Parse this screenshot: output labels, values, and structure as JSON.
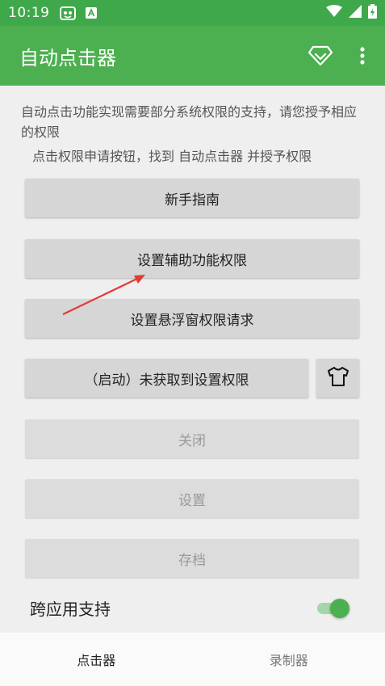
{
  "status": {
    "time": "10:19",
    "icons": [
      "tomcat-app-icon",
      "text-a-icon",
      "wifi-icon",
      "signal-icon",
      "battery-icon"
    ]
  },
  "app_bar": {
    "title": "自动点击器",
    "actions": [
      "diamond-icon",
      "more-vert-icon"
    ]
  },
  "colors": {
    "status_bar": "#3fa84a",
    "app_bar": "#4caf50",
    "switch_thumb": "#4caf50",
    "switch_track": "#a5d6a7",
    "arrow": "#e53935"
  },
  "content": {
    "description": "自动点击功能实现需要部分系统权限的支持，请您授予相应的权限",
    "hint": "点击权限申请按钮，找到 自动点击器 并授予权限",
    "buttons": {
      "guide": "新手指南",
      "accessibility": "设置辅助功能权限",
      "overlay": "设置悬浮窗权限请求",
      "start": "（启动）未获取到设置权限",
      "close": "关闭",
      "settings": "设置",
      "save": "存档"
    },
    "switch": {
      "label": "跨应用支持",
      "on": true
    }
  },
  "bottom_nav": {
    "tabs": [
      "点击器",
      "录制器"
    ],
    "active_index": 0
  }
}
